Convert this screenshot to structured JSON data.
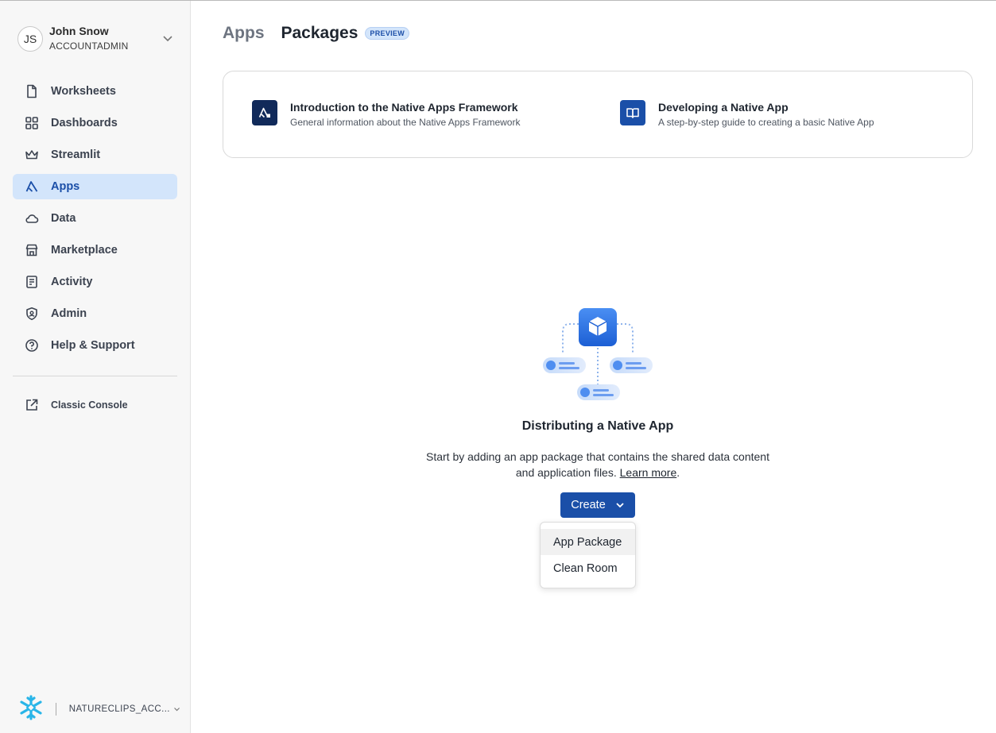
{
  "user": {
    "initials": "JS",
    "name": "John Snow",
    "role": "ACCOUNTADMIN"
  },
  "nav": {
    "items": [
      {
        "label": "Worksheets",
        "icon": "document-icon"
      },
      {
        "label": "Dashboards",
        "icon": "grid-icon"
      },
      {
        "label": "Streamlit",
        "icon": "crown-icon"
      },
      {
        "label": "Apps",
        "icon": "apps-icon",
        "active": true
      },
      {
        "label": "Data",
        "icon": "cloud-icon"
      },
      {
        "label": "Marketplace",
        "icon": "store-icon"
      },
      {
        "label": "Activity",
        "icon": "activity-icon"
      },
      {
        "label": "Admin",
        "icon": "shield-icon"
      },
      {
        "label": "Help & Support",
        "icon": "help-icon"
      }
    ],
    "classic": "Classic Console"
  },
  "account": {
    "name": "NATURECLIPS_ACC..."
  },
  "tabs": {
    "apps": "Apps",
    "packages": "Packages",
    "badge": "PREVIEW"
  },
  "guides": [
    {
      "title": "Introduction to the Native Apps Framework",
      "desc": "General information about the Native Apps Framework",
      "icon": "native-apps-icon"
    },
    {
      "title": "Developing a Native App",
      "desc": "A step-by-step guide to creating a basic Native App",
      "icon": "book-icon"
    }
  ],
  "empty": {
    "title": "Distributing a Native App",
    "desc_line1": "Start by adding an app package that contains the shared data content",
    "desc_line2_prefix": "and application files. ",
    "learn_more": "Learn more",
    "period": "."
  },
  "create": {
    "label": "Create"
  },
  "menu": {
    "items": [
      "App Package",
      "Clean Room"
    ]
  },
  "colors": {
    "accent": "#1a4fa8",
    "active_bg": "#d3e5fb",
    "guide_icon_dark": "#112a5a",
    "guide_icon_blue": "#1a4fa8"
  }
}
